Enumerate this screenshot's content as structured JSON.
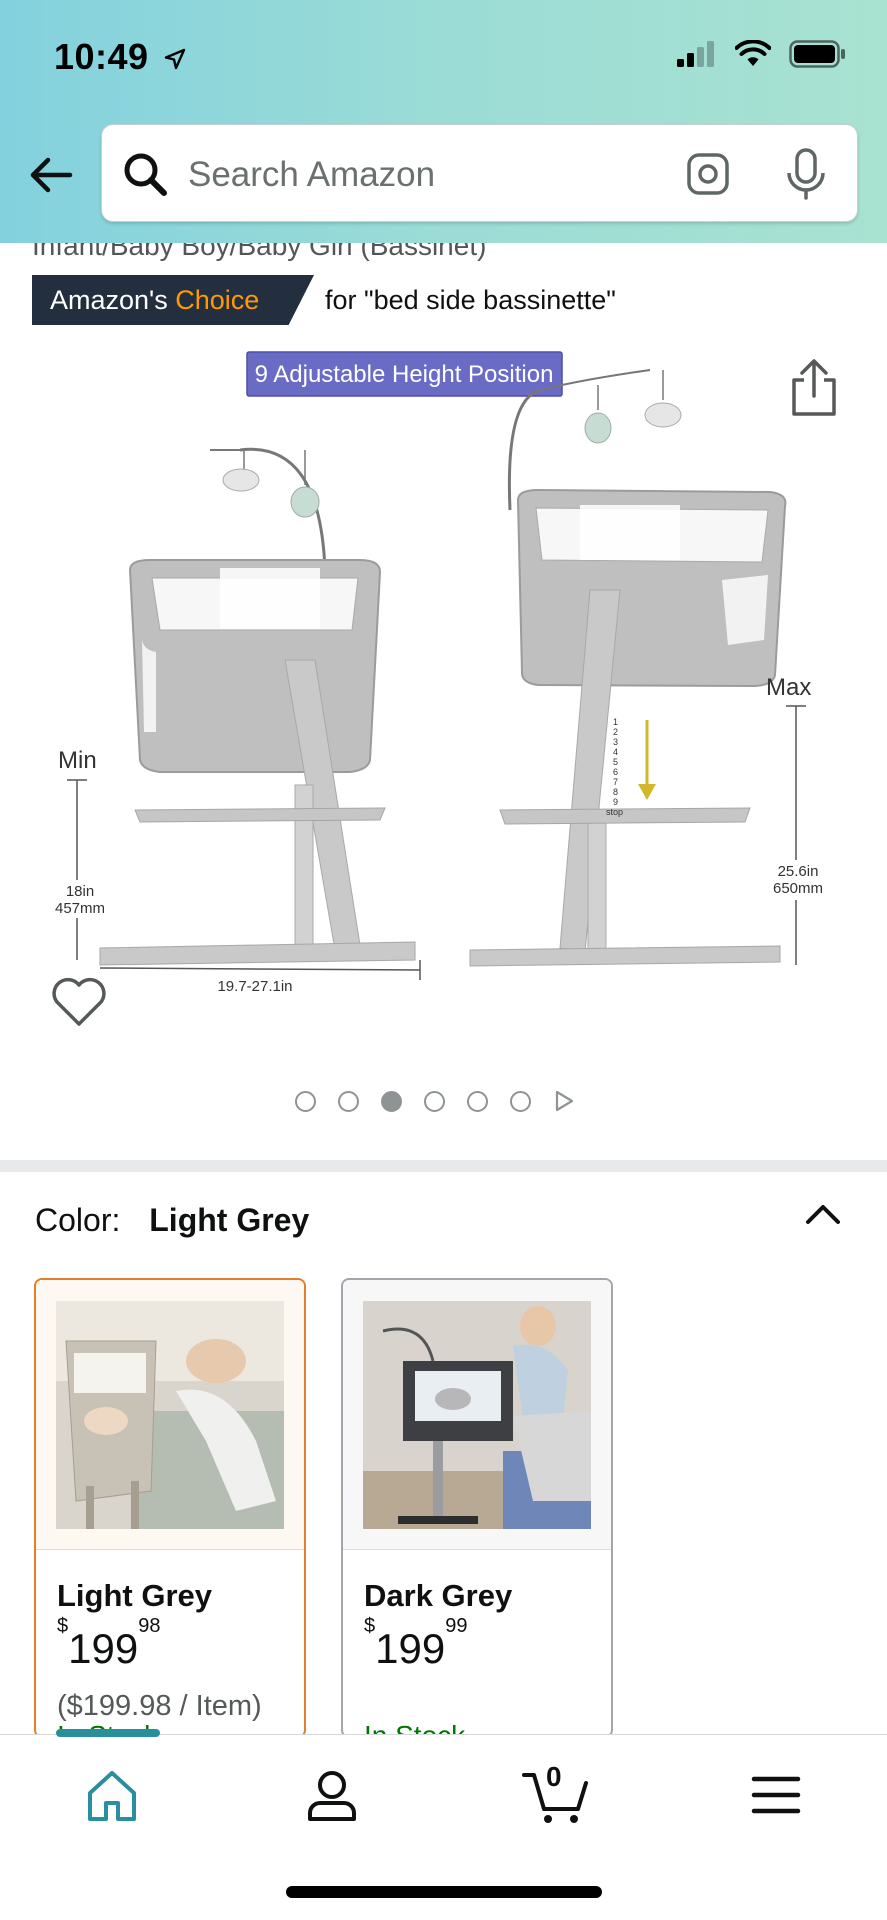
{
  "status_bar": {
    "time": "10:49",
    "icons": [
      "location-arrow-icon",
      "cellular-signal-icon",
      "wifi-icon",
      "battery-icon"
    ]
  },
  "header": {
    "back_icon": "back-arrow-icon",
    "search": {
      "placeholder": "Search Amazon",
      "icons": [
        "search-icon",
        "camera-scan-icon",
        "microphone-icon"
      ]
    },
    "gradient_colors": [
      "#83d1de",
      "#a8e2d1"
    ]
  },
  "product": {
    "title_fragment": "Infant/Baby Boy/Baby Girl (Bassinet)",
    "badge": {
      "prefix": "Amazon's ",
      "accent": "Choice",
      "query": "for \"bed side bassinette\""
    },
    "image_labels": {
      "banner": "9 Adjustable Height Position",
      "min": "Min",
      "max": "Max",
      "min_height_in": "18in",
      "min_height_mm": "457mm",
      "width_range": "19.7-27.1in",
      "max_height_in": "25.6in",
      "max_height_mm": "650mm",
      "scale_stop": "stop",
      "scale_numbers": [
        "1",
        "2",
        "3",
        "4",
        "5",
        "6",
        "7",
        "8",
        "9"
      ]
    },
    "carousel": {
      "count": 6,
      "active_index": 2
    }
  },
  "color_selector": {
    "label": "Color:",
    "selected": "Light Grey",
    "options": [
      {
        "name": "Light Grey",
        "currency": "$",
        "price_whole": "199",
        "price_fraction": "98",
        "unit_price": "($199.98 / Item)",
        "stock": "In Stock"
      },
      {
        "name": "Dark Grey",
        "currency": "$",
        "price_whole": "199",
        "price_fraction": "99",
        "unit_price": "",
        "stock": "In Stock"
      }
    ]
  },
  "bottom_nav": {
    "items": [
      "home-icon",
      "account-icon",
      "cart-icon",
      "menu-icon"
    ],
    "cart_count": "0",
    "active": "home"
  },
  "colors": {
    "accent_orange": "#ff9900",
    "badge_dark": "#232f3e",
    "selected_border": "#e17f2a",
    "stock_green": "#007600",
    "nav_active": "#2a8f9c"
  }
}
